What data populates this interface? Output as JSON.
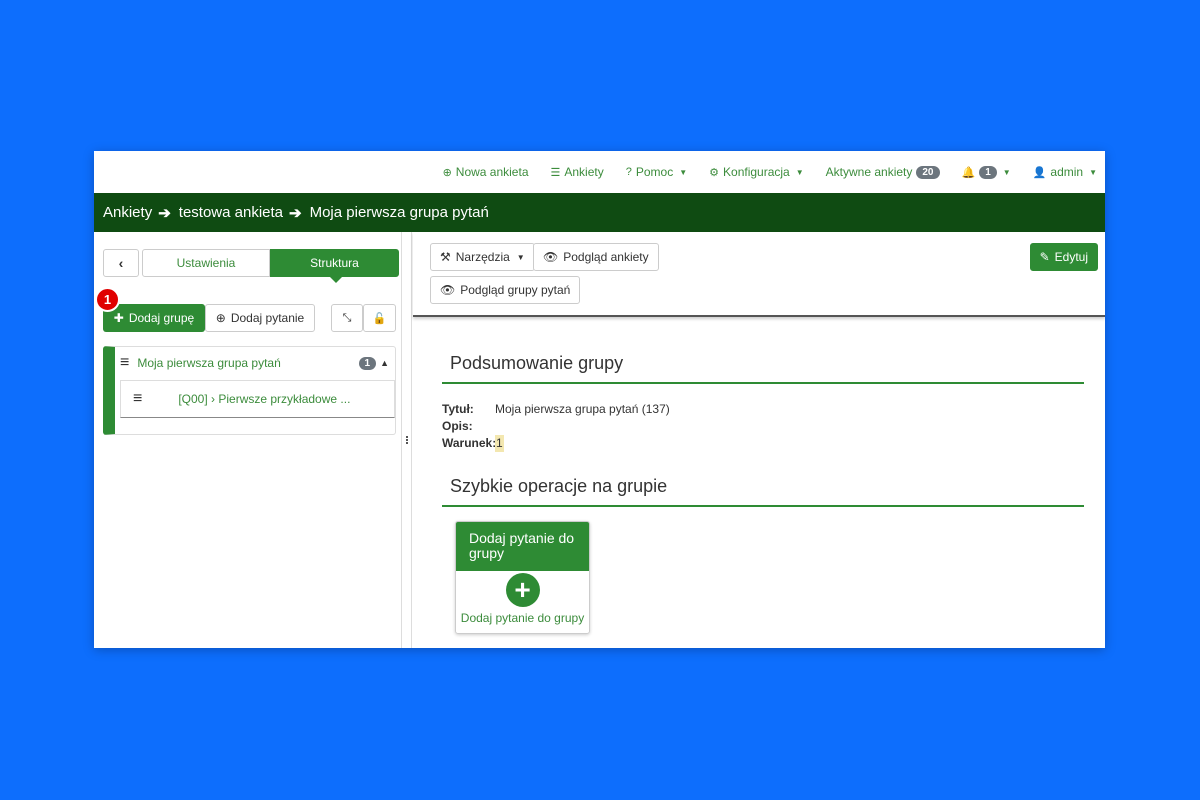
{
  "topnav": {
    "new_survey": "Nowa ankieta",
    "surveys": "Ankiety",
    "help": "Pomoc",
    "config": "Konfiguracja",
    "active_surveys": "Aktywne ankiety",
    "active_count": "20",
    "notif_count": "1",
    "user": "admin"
  },
  "breadcrumb": {
    "items": [
      "Ankiety",
      "testowa ankieta",
      "Moja pierwsza grupa pytań"
    ]
  },
  "left": {
    "tabs": {
      "settings": "Ustawienia",
      "structure": "Struktura"
    },
    "add_group": "Dodaj grupę",
    "add_question": "Dodaj pytanie",
    "step_badge": "1",
    "group": {
      "title": "Moja pierwsza grupa pytań",
      "count": "1",
      "question": "[Q00] › Pierwsze przykładowe ..."
    }
  },
  "right": {
    "tools": "Narzędzia",
    "preview_survey": "Podgląd ankiety",
    "preview_group": "Podgląd grupy pytań",
    "edit": "Edytuj",
    "summary_title": "Podsumowanie grupy",
    "fields": {
      "title_label": "Tytuł:",
      "title_value": "Moja pierwsza grupa pytań (137)",
      "desc_label": "Opis:",
      "cond_label": "Warunek:",
      "cond_value": "1"
    },
    "quick_title": "Szybkie operacje na grupie",
    "card": {
      "heading": "Dodaj pytanie do grupy",
      "link": "Dodaj pytanie do grupy"
    }
  },
  "colors": {
    "brand": "#2e8b34",
    "header": "#0f4b12",
    "background": "#0d6efd"
  }
}
